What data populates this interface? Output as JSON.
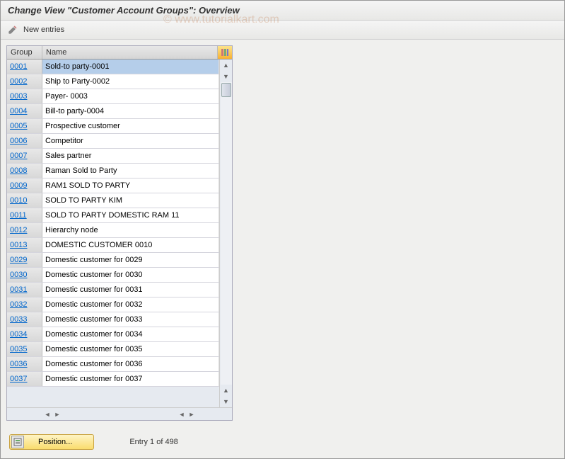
{
  "header": {
    "title": "Change View \"Customer Account Groups\": Overview"
  },
  "toolbar": {
    "new_entries_label": "New entries"
  },
  "table": {
    "headers": {
      "group": "Group",
      "name": "Name"
    },
    "rows": [
      {
        "group": "0001",
        "name": "Sold-to party-0001",
        "selected": true
      },
      {
        "group": "0002",
        "name": "Ship to Party-0002"
      },
      {
        "group": "0003",
        "name": "Payer- 0003"
      },
      {
        "group": "0004",
        "name": "Bill-to party-0004"
      },
      {
        "group": "0005",
        "name": "Prospective customer"
      },
      {
        "group": "0006",
        "name": "Competitor"
      },
      {
        "group": "0007",
        "name": "Sales partner"
      },
      {
        "group": "0008",
        "name": "Raman Sold to Party"
      },
      {
        "group": "0009",
        "name": "RAM1 SOLD TO PARTY"
      },
      {
        "group": "0010",
        "name": "SOLD TO PARTY KIM"
      },
      {
        "group": "0011",
        "name": "SOLD TO PARTY DOMESTIC RAM 11"
      },
      {
        "group": "0012",
        "name": "Hierarchy node"
      },
      {
        "group": "0013",
        "name": "DOMESTIC CUSTOMER 0010"
      },
      {
        "group": "0029",
        "name": "Domestic customer for  0029"
      },
      {
        "group": "0030",
        "name": "Domestic customer for  0030"
      },
      {
        "group": "0031",
        "name": "Domestic customer for  0031"
      },
      {
        "group": "0032",
        "name": "Domestic customer for  0032"
      },
      {
        "group": "0033",
        "name": "Domestic customer for  0033"
      },
      {
        "group": "0034",
        "name": "Domestic customer for  0034"
      },
      {
        "group": "0035",
        "name": "Domestic customer for  0035"
      },
      {
        "group": "0036",
        "name": "Domestic customer for  0036"
      },
      {
        "group": "0037",
        "name": "Domestic customer for  0037"
      }
    ]
  },
  "footer": {
    "position_button_label": "Position...",
    "entry_status": "Entry 1 of 498"
  },
  "watermark": "© www.tutorialkart.com"
}
